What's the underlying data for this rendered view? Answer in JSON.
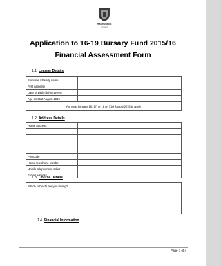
{
  "logo": {
    "name": "Haileybeck",
    "sub": "School",
    "icon": "school-crest-icon"
  },
  "title_line1": "Application to 16-19 Bursary Fund 2015/16",
  "title_line2": "Financial Assessment Form",
  "sections": {
    "learner": {
      "num": "1.1",
      "label": "Learner Details"
    },
    "address": {
      "num": "1.2",
      "label": "Address Details"
    },
    "course": {
      "num": "1.3",
      "label": "Course Details"
    },
    "financial": {
      "num": "1.4",
      "label": "Financial Information"
    }
  },
  "learner_fields": [
    "Surname / Family name",
    "First name(s)",
    "Date of Birth (dd/mm/yyyy)",
    "Age on 31st August 2015"
  ],
  "age_note": "You must be aged 16, 17, or 18 on 31st August 2015 to apply.",
  "address_fields": {
    "home_address": "Home Address",
    "postcode": "Postcode",
    "home_tel": "Home telephone number",
    "mobile_tel": "Mobile telephone number",
    "email": "E-mail address"
  },
  "course_question": "Which subjects are you taking?",
  "footer": "Page 1 of 4"
}
